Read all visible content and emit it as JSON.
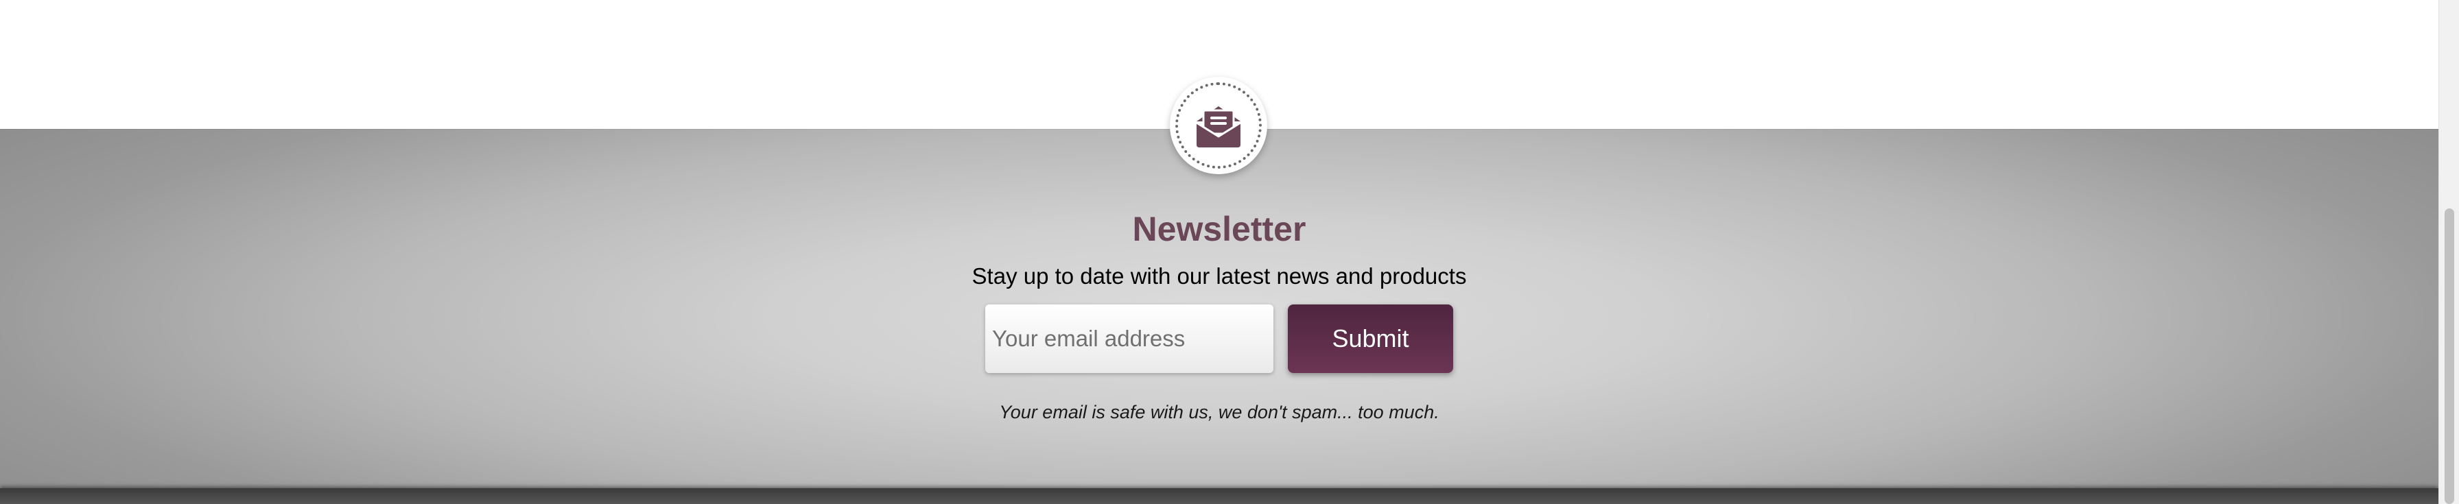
{
  "newsletter": {
    "icon": "open-envelope-letter-icon",
    "title": "Newsletter",
    "subtitle": "Stay up to date with our latest news and products",
    "email": {
      "value": "",
      "placeholder": "Your email address"
    },
    "submit_label": "Submit",
    "disclaimer": "Your email is safe with us, we don't spam... too much."
  },
  "colors": {
    "accent": "#6a4657",
    "button": "#5c2d49",
    "title": "#6a4657"
  }
}
